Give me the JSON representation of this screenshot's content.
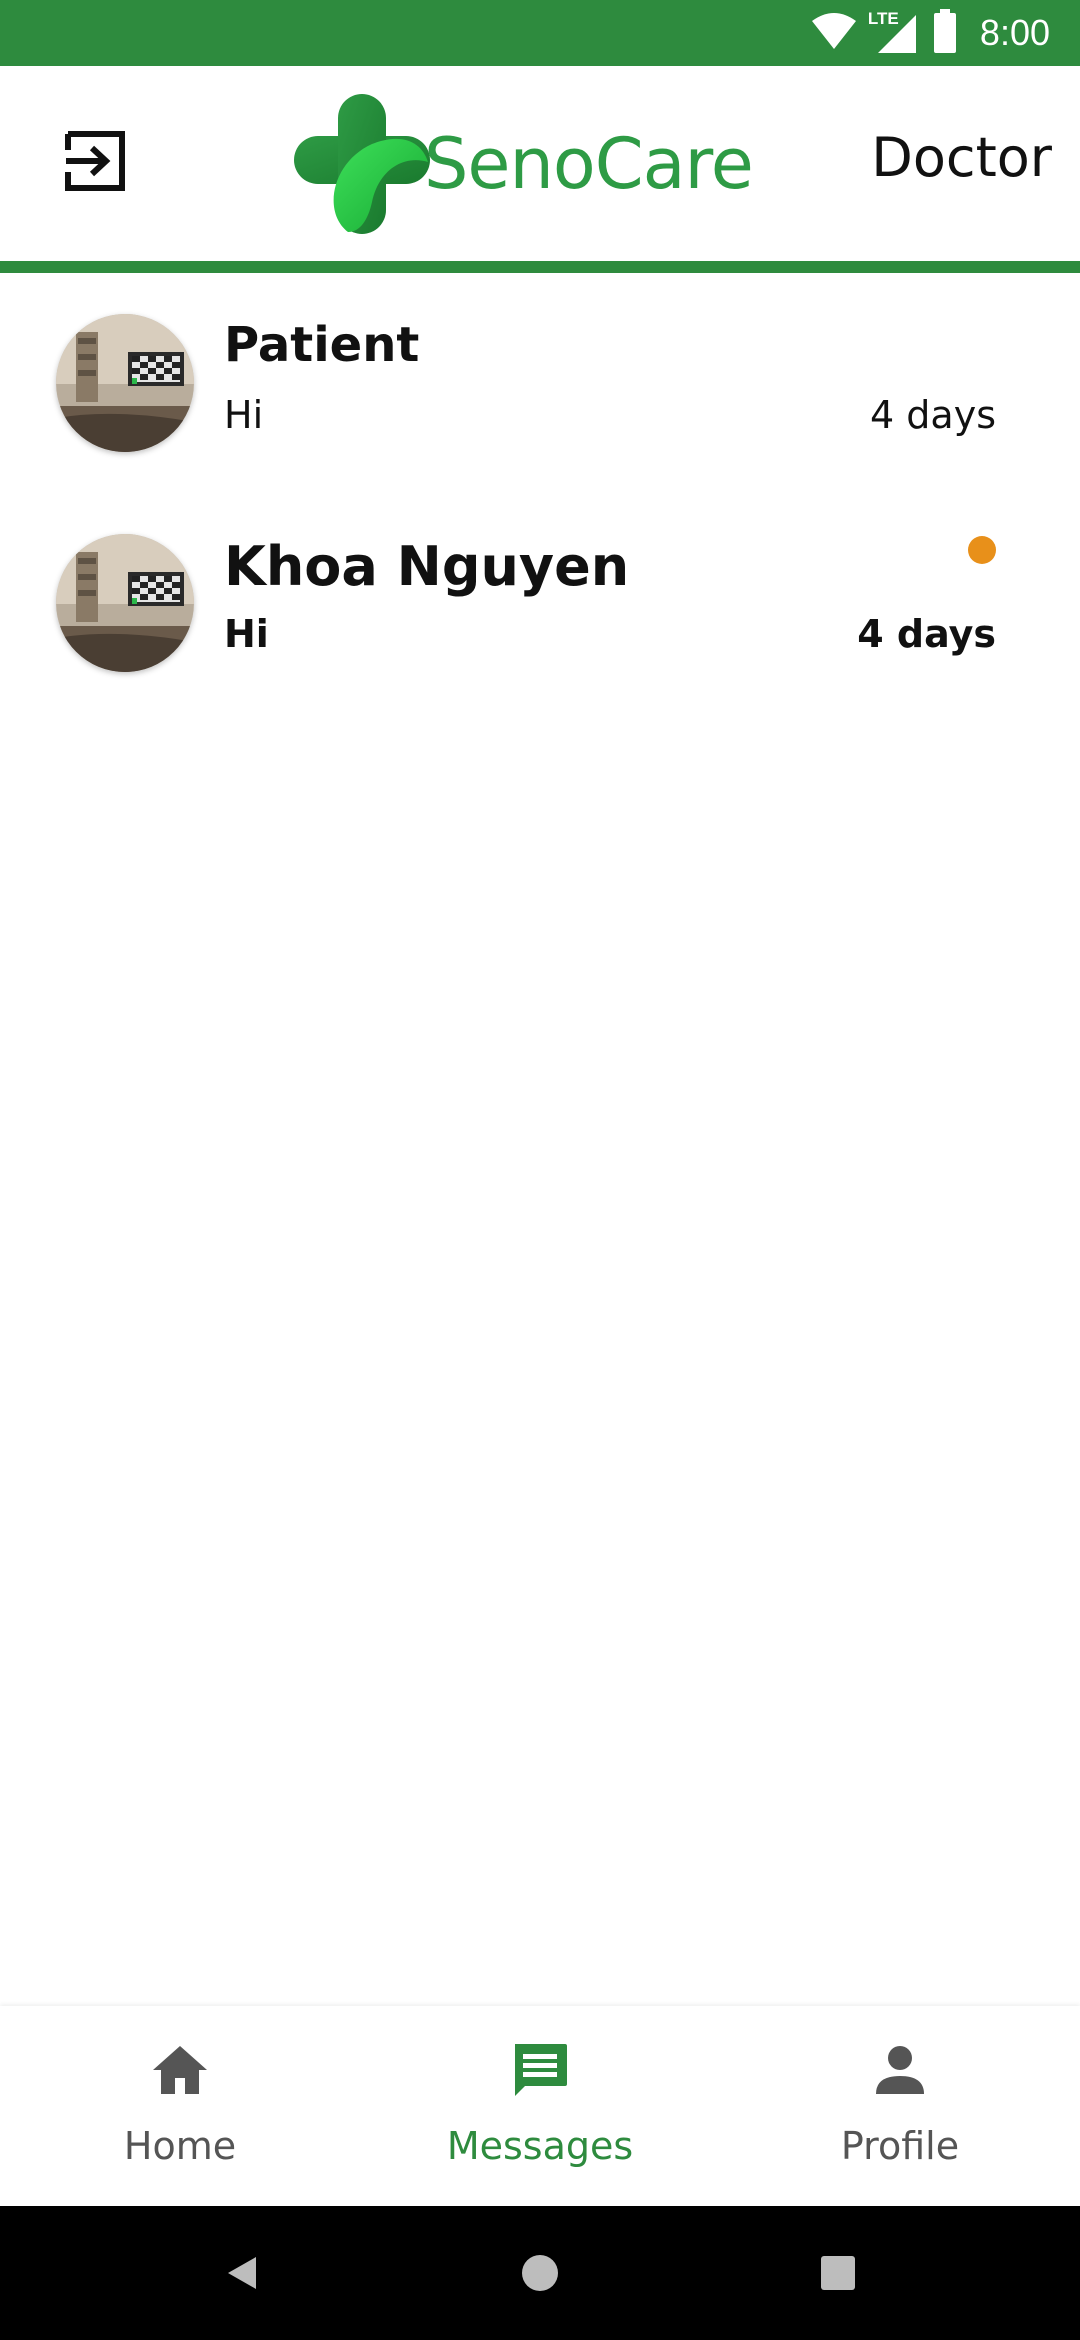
{
  "status_bar": {
    "network_label": "LTE",
    "time": "8:00",
    "background": "#2e8b3e"
  },
  "header": {
    "logout_icon": "logout-icon",
    "logo_text": "SenoCare",
    "role": "Doctor",
    "accent_color": "#2e8b3e"
  },
  "conversations": [
    {
      "name": "Patient",
      "preview": "Hi",
      "time": "4 days",
      "unread": false
    },
    {
      "name": "Khoa Nguyen",
      "preview": "Hi",
      "time": "4 days",
      "unread": true,
      "unread_color": "#e8901a"
    }
  ],
  "bottom_nav": {
    "items": [
      {
        "label": "Home",
        "icon": "home-icon",
        "active": false
      },
      {
        "label": "Messages",
        "icon": "message-icon",
        "active": true
      },
      {
        "label": "Profile",
        "icon": "person-icon",
        "active": false
      }
    ],
    "active_color": "#2e8b3e",
    "inactive_color": "#555555"
  },
  "system_nav": {
    "buttons": [
      "back-icon",
      "home-circle-icon",
      "recents-icon"
    ]
  }
}
